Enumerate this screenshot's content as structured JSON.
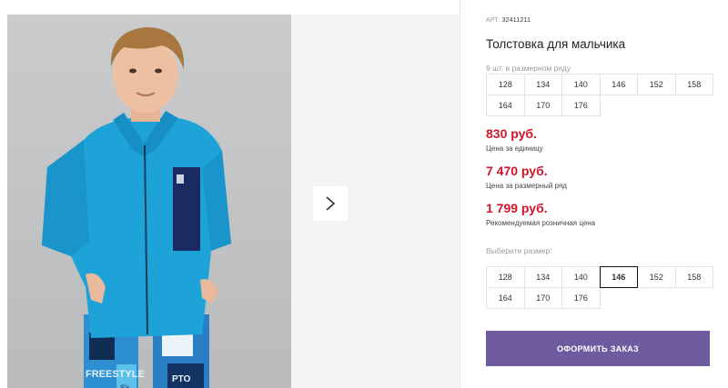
{
  "product": {
    "article_label": "АРТ.",
    "article_value": "32411211",
    "title": "Толстовка для мальчика",
    "size_row_note": "9 шт. в размерном ряду"
  },
  "size_row": [
    "128",
    "134",
    "140",
    "146",
    "152",
    "158",
    "164",
    "170",
    "176"
  ],
  "prices": [
    {
      "value": "830 руб.",
      "label": "Цена за единицу"
    },
    {
      "value": "7 470 руб.",
      "label": "Цена за размерный ряд"
    },
    {
      "value": "1 799 руб.",
      "label": "Рекомендуемая розничная цена"
    }
  ],
  "size_select": {
    "label": "Выберите размер:",
    "options": [
      "128",
      "134",
      "140",
      "146",
      "152",
      "158",
      "164",
      "170",
      "176"
    ],
    "selected": "146"
  },
  "order_button": "ОФОРМИТЬ ЗАКАЗ",
  "photo_print": {
    "line1": "FREESTYLE",
    "line2": "Sk",
    "line3": "PTO"
  },
  "colors": {
    "price": "#d2142a",
    "button": "#6e5a9e",
    "fleece": "#1ea3d8",
    "pocket": "#1c2a63"
  }
}
